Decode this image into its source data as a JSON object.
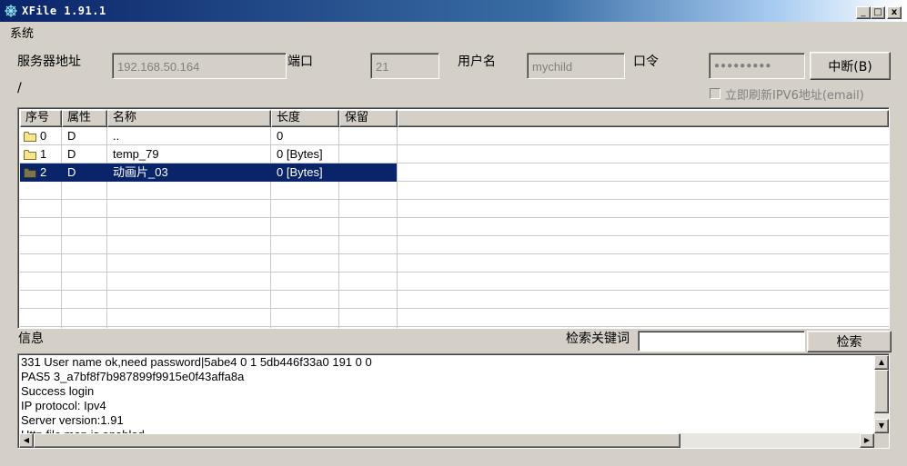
{
  "window": {
    "title": "XFile 1.91.1",
    "controls": {
      "minimize": "_",
      "maximize": "□",
      "close": "x"
    }
  },
  "menu": {
    "system": "系统"
  },
  "connection": {
    "server_label": "服务器地址",
    "server_value": "192.168.50.164",
    "port_label": "端口",
    "port_value": "21",
    "user_label": "用户名",
    "user_value": "mychild",
    "password_label": "口令",
    "password_value": "●●●●●●●●●",
    "interrupt_button": "中断(B)",
    "ipv6_checkbox_label": "立即刷新IPV6地址(email)",
    "ipv6_checked": false,
    "current_path": "/"
  },
  "file_table": {
    "columns": [
      "序号",
      "属性",
      "名称",
      "长度",
      "保留"
    ],
    "rows": [
      {
        "index": "0",
        "attr": "D",
        "name": "..",
        "length": "0",
        "reserved": "",
        "selected": false
      },
      {
        "index": "1",
        "attr": "D",
        "name": "temp_79",
        "length": "0 [Bytes]",
        "reserved": "",
        "selected": false
      },
      {
        "index": "2",
        "attr": "D",
        "name": "动画片_03",
        "length": "0 [Bytes]",
        "reserved": "",
        "selected": true
      }
    ]
  },
  "info": {
    "label": "信息",
    "search_label": "检索关键词",
    "search_value": "",
    "search_button": "检索",
    "log_lines": [
      "331 User name ok,need password|5abe4 0 1 5db446f33a0 191 0 0",
      "PAS5 3_a7bf8f7b987899f9915e0f43affa8a",
      "Success login",
      "IP protocol: Ipv4",
      "Server version:1.91",
      "Http file map is enabled"
    ]
  },
  "colors": {
    "window_bg": "#d4d0c8",
    "title_bar": "#0a246a",
    "selection": "#0a246a",
    "folder": "#f5e68c"
  },
  "icons": {
    "app": "app-icon",
    "folder": "folder-icon",
    "scroll_up": "▲",
    "scroll_down": "▼",
    "scroll_left": "◀",
    "scroll_right": "▶"
  }
}
